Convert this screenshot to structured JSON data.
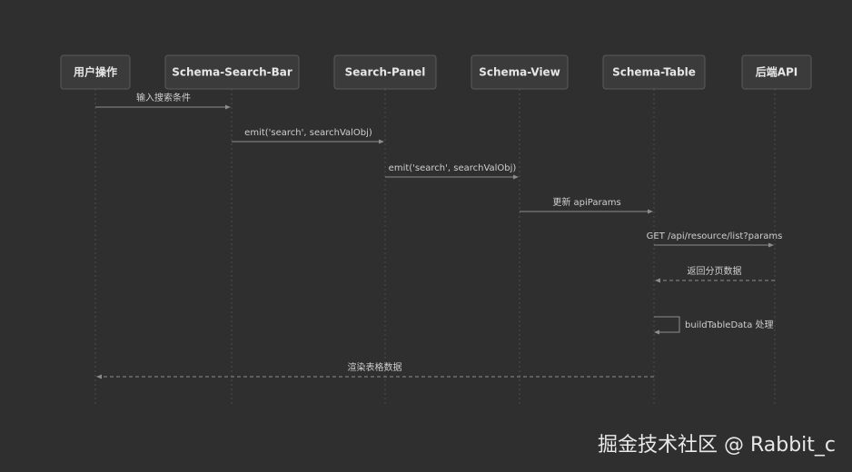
{
  "diagram": {
    "participants": [
      {
        "id": "user",
        "label": "用户操作"
      },
      {
        "id": "bar",
        "label": "Schema-Search-Bar"
      },
      {
        "id": "panel",
        "label": "Search-Panel"
      },
      {
        "id": "view",
        "label": "Schema-View"
      },
      {
        "id": "table",
        "label": "Schema-Table"
      },
      {
        "id": "api",
        "label": "后端API"
      }
    ],
    "messages": [
      {
        "from": "user",
        "to": "bar",
        "label": "输入搜索条件",
        "style": "solid"
      },
      {
        "from": "bar",
        "to": "panel",
        "label": "emit('search', searchValObj)",
        "style": "solid"
      },
      {
        "from": "panel",
        "to": "view",
        "label": "emit('search', searchValObj)",
        "style": "solid"
      },
      {
        "from": "view",
        "to": "table",
        "label": "更新 apiParams",
        "style": "solid"
      },
      {
        "from": "table",
        "to": "api",
        "label": "GET /api/resource/list?params",
        "style": "solid"
      },
      {
        "from": "api",
        "to": "table",
        "label": "返回分页数据",
        "style": "dashed"
      },
      {
        "from": "table",
        "to": "table",
        "label": "buildTableData 处理",
        "style": "solid"
      },
      {
        "from": "table",
        "to": "user",
        "label": "渲染表格数据",
        "style": "dashed"
      }
    ]
  },
  "watermark": "掘金技术社区 @ Rabbit_c"
}
